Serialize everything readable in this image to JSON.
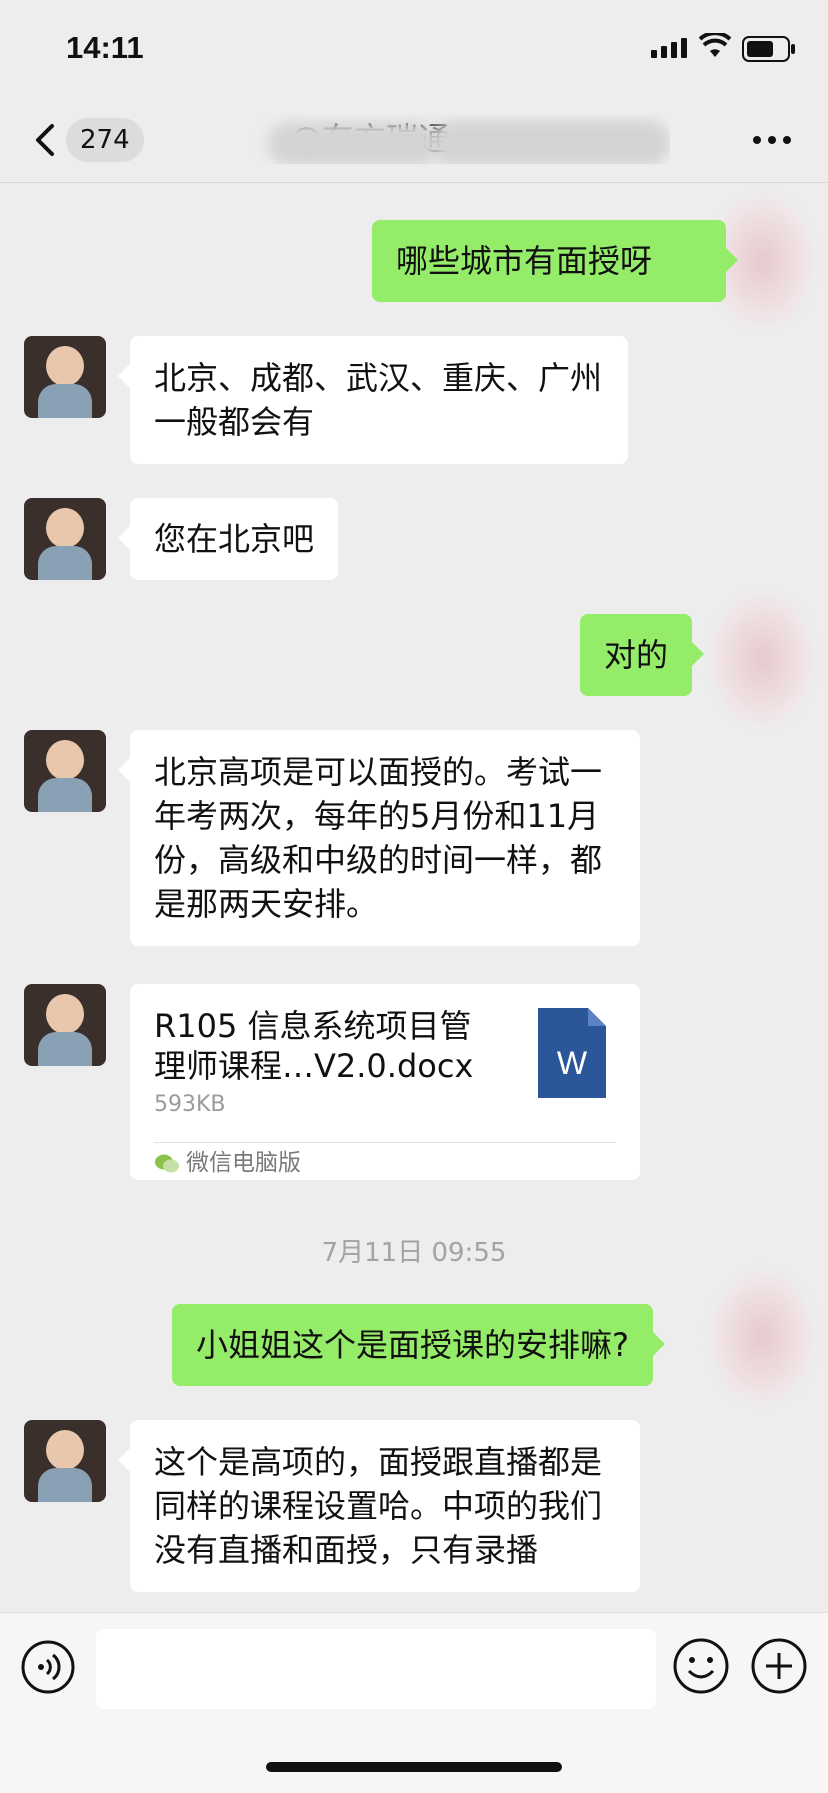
{
  "status_bar": {
    "time": "14:11"
  },
  "header": {
    "unread_count": "274",
    "title": "@东方瑞通"
  },
  "messages": [
    {
      "side": "out",
      "text": "哪些城市有面授呀"
    },
    {
      "side": "in",
      "text": "北京、成都、武汉、重庆、广州一般都会有"
    },
    {
      "side": "in",
      "text": "您在北京吧"
    },
    {
      "side": "out",
      "text": "对的"
    },
    {
      "side": "in",
      "text": "北京高项是可以面授的。考试一年考两次，每年的5月份和11月份，高级和中级的时间一样，都是那两天安排。"
    },
    {
      "side": "in",
      "type": "file",
      "file_name": "R105 信息系统项目管理师课程…V2.0.docx",
      "file_size": "593KB",
      "file_icon_letter": "W",
      "source": "微信电脑版"
    },
    {
      "side": "out",
      "text": "小姐姐这个是面授课的安排嘛?"
    },
    {
      "side": "in",
      "text": "这个是高项的，面授跟直播都是同样的课程设置哈。中项的我们没有直播和面授，只有录播"
    }
  ],
  "timestamp": "7月11日 09:55",
  "colors": {
    "background": "#ededed",
    "outgoing_bubble": "#95ec69",
    "incoming_bubble": "#ffffff",
    "file_icon": "#2b579a"
  },
  "icons": {
    "back": "chevron-left-icon",
    "more": "more-dots-icon",
    "voice": "voice-icon",
    "emoji": "emoji-icon",
    "plus": "plus-icon",
    "document": "word-doc-icon",
    "source": "wechat-icon"
  }
}
